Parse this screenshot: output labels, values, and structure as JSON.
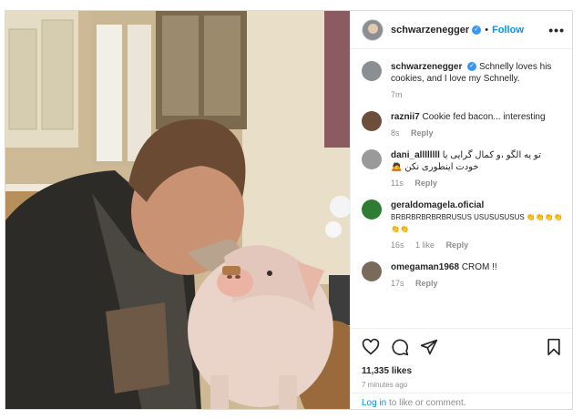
{
  "post": {
    "author": "schwarzenegger",
    "follow_label": "Follow",
    "separator": "•",
    "more_label": "•••",
    "likes": "11,335 likes",
    "time_ago": "7 minutes ago",
    "login_link": "Log in",
    "login_suffix": " to like or comment."
  },
  "comments": [
    {
      "user": "schwarzenegger",
      "verified": true,
      "text": "Schnelly loves his cookies, and I love my Schnelly.",
      "time": "7m",
      "likes": "",
      "reply": "",
      "avatar_color": "#8b8f93"
    },
    {
      "user": "raznii7",
      "verified": false,
      "text": "Cookie fed bacon... interesting",
      "time": "8s",
      "likes": "",
      "reply": "Reply",
      "avatar_color": "#6b4f3a"
    },
    {
      "user": "dani_allllllll",
      "verified": false,
      "text": "تو یه الگو ،و کمال گرایی یا خودت اینطوری نکن 🙇",
      "time": "11s",
      "likes": "",
      "reply": "Reply",
      "avatar_color": "#9a9a9a"
    },
    {
      "user": "geraldomagela.oficial",
      "verified": false,
      "text": "BRBRBRBRBRBRUSUS USUSUSUSUS 👏👏👏👏👏👏",
      "time": "16s",
      "likes": "1 like",
      "reply": "Reply",
      "avatar_color": "#2e7d32"
    },
    {
      "user": "omegaman1968",
      "verified": false,
      "text": "CROM !!",
      "time": "17s",
      "likes": "",
      "reply": "Reply",
      "avatar_color": "#7a6a5a"
    }
  ],
  "icons": [
    "heart-icon",
    "comment-icon",
    "share-icon",
    "bookmark-icon"
  ],
  "colors": {
    "link": "#0095f6",
    "verified": "#3897f0",
    "muted": "#8e8e8e"
  }
}
